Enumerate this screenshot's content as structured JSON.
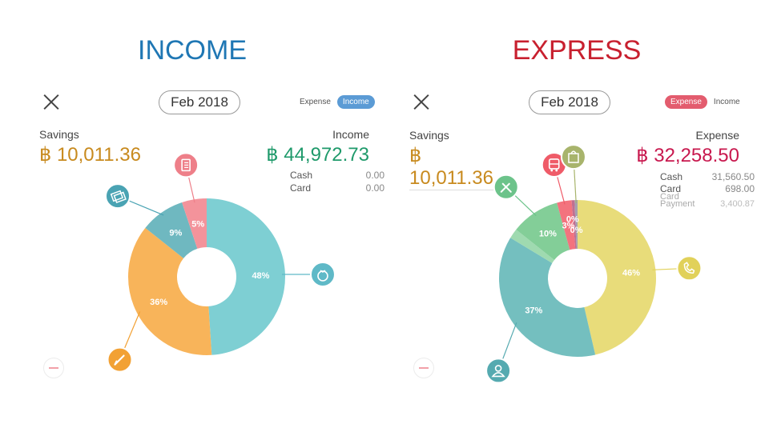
{
  "income_panel": {
    "heading": "INCOME",
    "month": "Feb 2018",
    "toggle": {
      "expense": "Expense",
      "income": "Income"
    },
    "savings_label": "Savings",
    "savings_amount": "฿ 10,011.36",
    "total_label": "Income",
    "total_amount": "฿ 44,972.73",
    "breakdown": [
      {
        "label": "Cash",
        "value": "0.00"
      },
      {
        "label": "Card",
        "value": "0.00"
      }
    ],
    "donut": [
      {
        "percent": 48,
        "label": "48%",
        "color": "#7ecfd3",
        "icon": "money-bag-icon",
        "icon_color": "#5fb9c7"
      },
      {
        "percent": 36,
        "label": "36%",
        "color": "#f8b45a",
        "icon": "pencil-icon",
        "icon_color": "#f2a134"
      },
      {
        "percent": 9,
        "label": "9%",
        "color": "#6fb8c0",
        "icon": "banknotes-icon",
        "icon_color": "#4aa3b3"
      },
      {
        "percent": 5,
        "label": "5%",
        "color": "#f3939b",
        "icon": "notebook-icon",
        "icon_color": "#ee7f89"
      }
    ]
  },
  "expense_panel": {
    "heading": "EXPRESS",
    "month": "Feb 2018",
    "toggle": {
      "expense": "Expense",
      "income": "Income"
    },
    "savings_label": "Savings",
    "savings_amount": "฿ 10,011.36",
    "total_label": "Expense",
    "total_amount": "฿ 32,258.50",
    "breakdown": [
      {
        "label": "Cash",
        "value": "31,560.50"
      },
      {
        "label": "Card",
        "value": "698.00"
      },
      {
        "label": "Card Payment",
        "value": "3,400.87"
      }
    ],
    "donut": [
      {
        "percent": 46,
        "label": "46%",
        "color": "#e8dc7a",
        "icon": "phone-icon",
        "icon_color": "#e1d15a"
      },
      {
        "percent": 37,
        "label": "37%",
        "color": "#74bfbf",
        "icon": "person-icon",
        "icon_color": "#55aab0"
      },
      {
        "percent": 2,
        "label": "",
        "color": "#9fdab0",
        "icon": "",
        "icon_color": ""
      },
      {
        "percent": 10,
        "label": "10%",
        "color": "#83ce98",
        "icon": "fork-knife-icon",
        "icon_color": "#6cc38a"
      },
      {
        "percent": 3,
        "label": "3%",
        "color": "#f3737e",
        "icon": "bus-icon",
        "icon_color": "#ef5b68"
      },
      {
        "percent": 0.6,
        "label": "0%",
        "color": "#c06f90",
        "icon": "",
        "icon_color": "#a65d7f"
      },
      {
        "percent": 0.6,
        "label": "0%",
        "color": "#a69fb0",
        "icon": "shopping-bag-icon",
        "icon_color": "#a8b46c"
      }
    ]
  },
  "colors": {
    "income_heading": "#1f77b4",
    "expense_heading": "#c8202f",
    "savings": "#c88a1e",
    "income_total": "#1f9a6b",
    "expense_total": "#c8184e"
  }
}
